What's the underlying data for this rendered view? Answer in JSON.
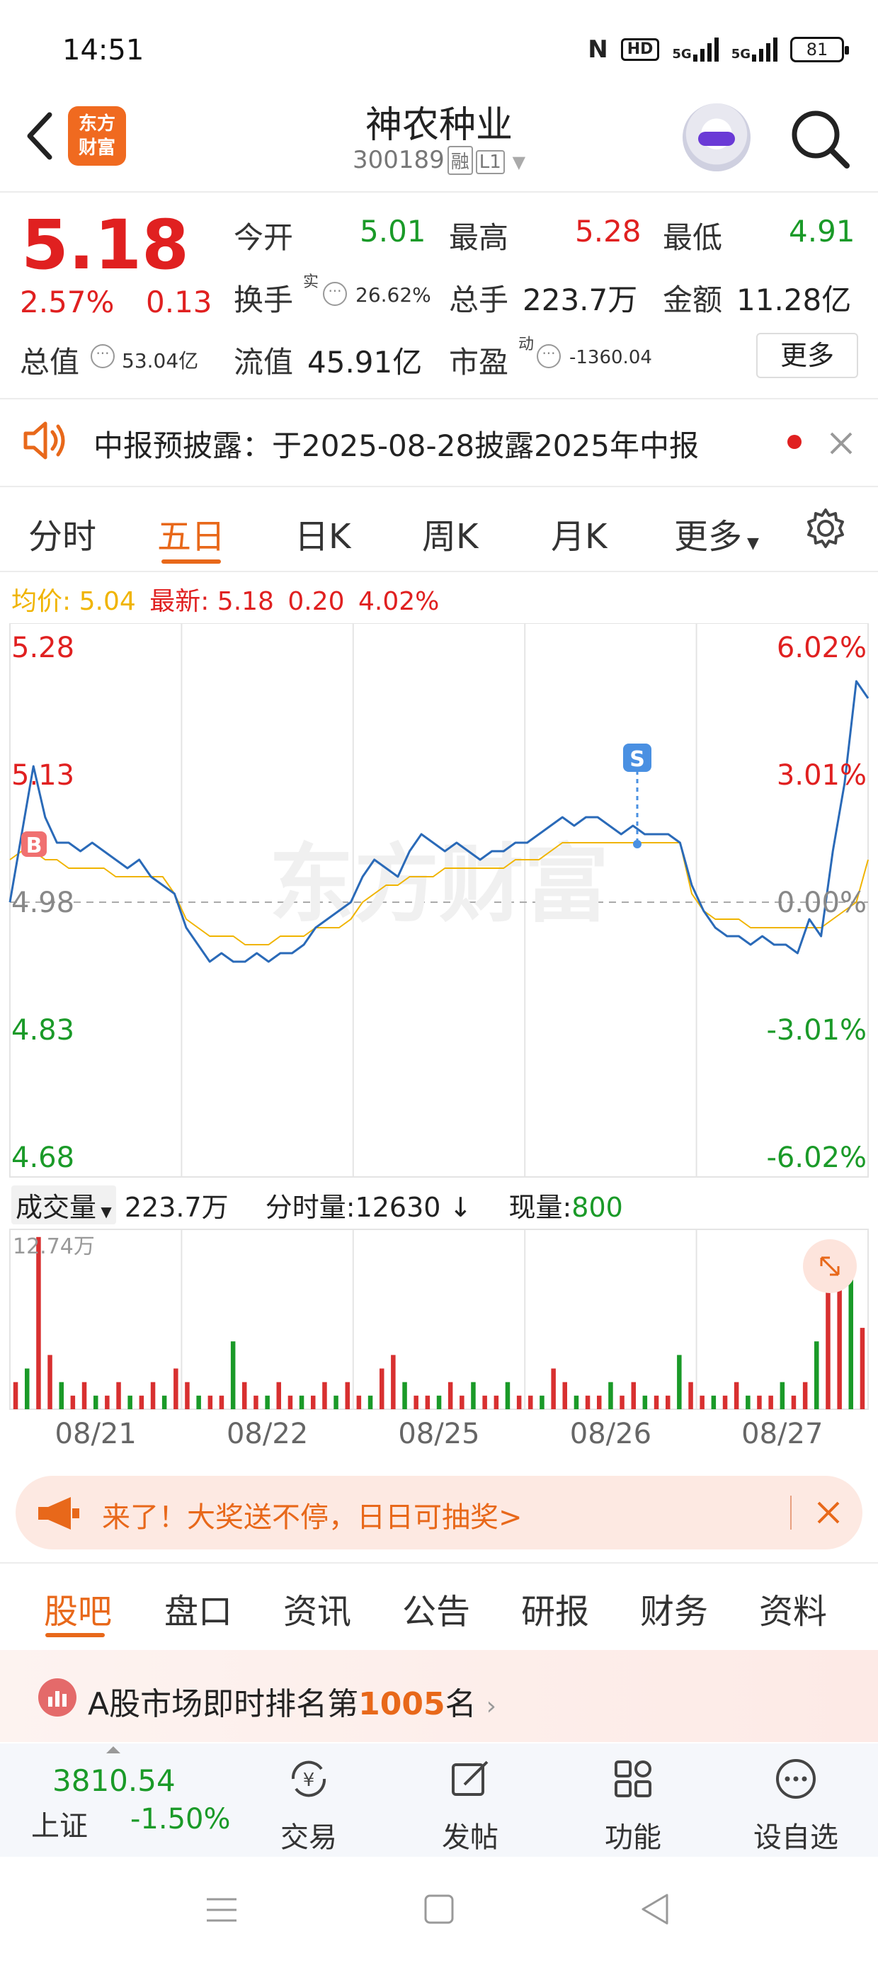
{
  "status_bar": {
    "time": "14:51",
    "hd_label": "HD",
    "net1": "5G",
    "net2": "5G",
    "battery": "81"
  },
  "header": {
    "logo_line1": "东方",
    "logo_line2": "财富",
    "stock_name": "神农种业",
    "stock_code": "300189",
    "tag_rong": "融",
    "tag_level": "L1"
  },
  "quote": {
    "price": "5.18",
    "change_pct": "2.57%",
    "change_abs": "0.13",
    "open_label": "今开",
    "open_value": "5.01",
    "high_label": "最高",
    "high_value": "5.28",
    "low_label": "最低",
    "low_value": "4.91",
    "turnover_label": "换手",
    "turnover_sup": "实",
    "turnover_value": "26.62%",
    "volume_label": "总手",
    "volume_value": "223.7万",
    "amount_label": "金额",
    "amount_value": "11.28亿",
    "mktcap_label": "总值",
    "mktcap_value": "53.04亿",
    "float_label": "流值",
    "float_value": "45.91亿",
    "pe_label": "市盈",
    "pe_sup": "动",
    "pe_value": "-1360.04",
    "more_label": "更多"
  },
  "notice": {
    "text": "中报预披露：于2025-08-28披露2025年中报"
  },
  "chart_tabs": [
    "分时",
    "五日",
    "日K",
    "周K",
    "月K",
    "更多"
  ],
  "legend": {
    "avg_label": "均价:",
    "avg_value": "5.04",
    "latest_label": "最新:",
    "latest_price": "5.18",
    "latest_change": "0.20",
    "latest_pct": "4.02%"
  },
  "volume_header": {
    "selector_label": "成交量",
    "total": "223.7万",
    "tick_label": "分时量:",
    "tick_value": "12630",
    "now_label": "现量:",
    "now_value": "800"
  },
  "banner": {
    "text": "来了！大奖送不停，日日可抽奖>"
  },
  "bottom_tabs": [
    "股吧",
    "盘口",
    "资讯",
    "公告",
    "研报",
    "财务",
    "资料"
  ],
  "rank": {
    "prefix": "A股市场即时排名第",
    "number": "1005",
    "suffix": "名"
  },
  "bottom_nav": {
    "index_value": "3810.54",
    "index_name": "上证",
    "index_change": "-1.50%",
    "items": [
      "交易",
      "发帖",
      "功能",
      "设自选"
    ]
  },
  "chart_data": {
    "type": "line",
    "x_labels": [
      "08/21",
      "08/22",
      "08/25",
      "08/26",
      "08/27"
    ],
    "y_left_labels": [
      "5.28",
      "5.13",
      "4.98",
      "4.83",
      "4.68"
    ],
    "y_right_labels": [
      "6.02%",
      "3.01%",
      "0.00%",
      "-3.01%",
      "-6.02%"
    ],
    "ylim": [
      4.68,
      5.28
    ],
    "prev_close": 4.98,
    "watermark": "东方财富",
    "markers": {
      "buy": "B",
      "sell": "S"
    },
    "series": [
      {
        "name": "price",
        "values": [
          4.98,
          5.06,
          5.14,
          5.08,
          5.05,
          5.05,
          5.04,
          5.05,
          5.04,
          5.03,
          5.02,
          5.03,
          5.01,
          5.0,
          4.99,
          4.95,
          4.93,
          4.91,
          4.92,
          4.91,
          4.91,
          4.92,
          4.91,
          4.92,
          4.92,
          4.93,
          4.95,
          4.96,
          4.97,
          4.98,
          5.01,
          5.03,
          5.02,
          5.01,
          5.04,
          5.06,
          5.05,
          5.04,
          5.05,
          5.04,
          5.03,
          5.04,
          5.04,
          5.05,
          5.05,
          5.06,
          5.07,
          5.08,
          5.07,
          5.08,
          5.08,
          5.07,
          5.06,
          5.07,
          5.06,
          5.06,
          5.06,
          5.05,
          5.0,
          4.97,
          4.95,
          4.94,
          4.94,
          4.93,
          4.94,
          4.93,
          4.93,
          4.92,
          4.96,
          4.94,
          5.04,
          5.12,
          5.24,
          5.22
        ]
      },
      {
        "name": "avg",
        "values": [
          5.03,
          5.04,
          5.04,
          5.03,
          5.03,
          5.02,
          5.02,
          5.02,
          5.02,
          5.01,
          5.01,
          5.01,
          5.01,
          5.01,
          4.99,
          4.96,
          4.95,
          4.94,
          4.94,
          4.94,
          4.93,
          4.93,
          4.93,
          4.94,
          4.94,
          4.94,
          4.95,
          4.95,
          4.95,
          4.96,
          4.98,
          4.99,
          5.0,
          5.0,
          5.01,
          5.01,
          5.01,
          5.02,
          5.02,
          5.02,
          5.02,
          5.02,
          5.02,
          5.03,
          5.03,
          5.03,
          5.04,
          5.05,
          5.05,
          5.05,
          5.05,
          5.05,
          5.05,
          5.05,
          5.05,
          5.05,
          5.05,
          5.05,
          4.99,
          4.97,
          4.96,
          4.96,
          4.96,
          4.95,
          4.95,
          4.95,
          4.95,
          4.95,
          4.95,
          4.95,
          4.96,
          4.97,
          4.98,
          5.03
        ]
      }
    ],
    "volume_ylabel": "12.74万",
    "volume_values": [
      2,
      3,
      12.7,
      4,
      2,
      1,
      2,
      1,
      1,
      2,
      1,
      1,
      2,
      1,
      3,
      2,
      1,
      1,
      1,
      5,
      2,
      1,
      1,
      2,
      1,
      1,
      1,
      2,
      1,
      2,
      1,
      1,
      3,
      4,
      2,
      1,
      1,
      1,
      2,
      1,
      2,
      1,
      1,
      2,
      1,
      1,
      1,
      3,
      2,
      1,
      1,
      1,
      2,
      1,
      2,
      1,
      1,
      1,
      4,
      2,
      1,
      1,
      1,
      2,
      1,
      1,
      1,
      2,
      1,
      2,
      5,
      12.5,
      9,
      10,
      6
    ]
  }
}
